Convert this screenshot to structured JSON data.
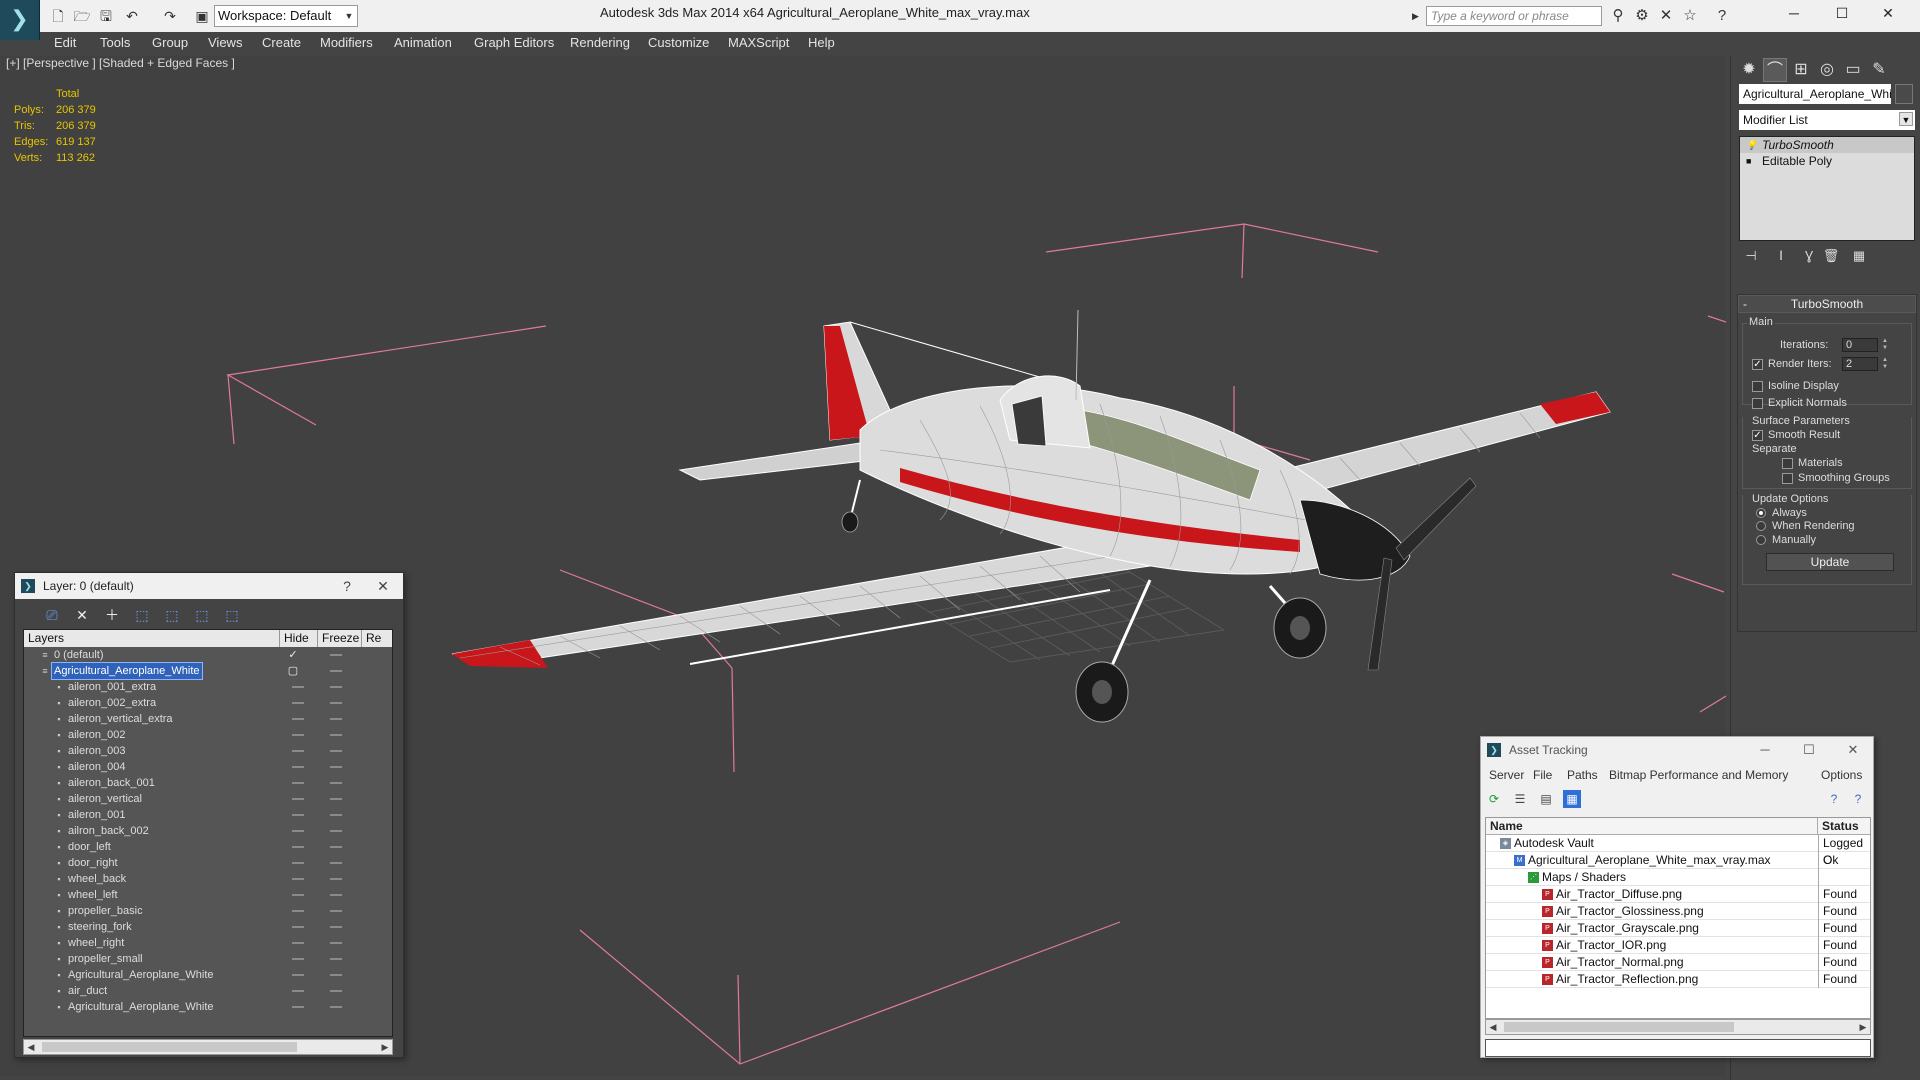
{
  "app": {
    "title": "Autodesk 3ds Max  2014 x64      Agricultural_Aeroplane_White_max_vray.max",
    "logo": "3ds-max-logo",
    "workspace": "Workspace: Default",
    "search_placeholder": "Type a keyword or phrase"
  },
  "menu": [
    "Edit",
    "Tools",
    "Group",
    "Views",
    "Create",
    "Modifiers",
    "Animation",
    "Graph Editors",
    "Rendering",
    "Customize",
    "MAXScript",
    "Help"
  ],
  "viewport": {
    "label": "[+] [Perspective ] [Shaded + Edged Faces ]",
    "stats_header": "Total",
    "stats": [
      {
        "label": "Polys:",
        "value": "206 379"
      },
      {
        "label": "Tris:",
        "value": "206 379"
      },
      {
        "label": "Edges:",
        "value": "619 137"
      },
      {
        "label": "Verts:",
        "value": "113 262"
      }
    ]
  },
  "command_panel": {
    "object_name": "Agricultural_Aeroplane_White",
    "modifier_list": "Modifier List",
    "stack": [
      "TurboSmooth",
      "Editable Poly"
    ],
    "rollout_title": "TurboSmooth",
    "main_group": "Main",
    "iterations_label": "Iterations:",
    "iterations_value": "0",
    "render_iters_label": "Render Iters:",
    "render_iters_value": "2",
    "isoline_label": "Isoline Display",
    "explicit_label": "Explicit Normals",
    "surface_group": "Surface Parameters",
    "smooth_result_label": "Smooth Result",
    "separate_label": "Separate",
    "materials_label": "Materials",
    "smoothing_groups_label": "Smoothing Groups",
    "update_group": "Update Options",
    "always_label": "Always",
    "when_rendering_label": "When Rendering",
    "manually_label": "Manually",
    "update_button": "Update"
  },
  "layer_panel": {
    "title": "Layer: 0 (default)",
    "help": "?",
    "columns": [
      "Layers",
      "Hide",
      "Freeze",
      "Re"
    ],
    "rows": [
      {
        "name": "0 (default)",
        "level": 0,
        "type": "layer"
      },
      {
        "name": "Agricultural_Aeroplane_White",
        "level": 0,
        "type": "layer",
        "selected": true
      },
      {
        "name": "aileron_001_extra",
        "level": 1,
        "type": "object"
      },
      {
        "name": "aileron_002_extra",
        "level": 1,
        "type": "object"
      },
      {
        "name": "aileron_vertical_extra",
        "level": 1,
        "type": "object"
      },
      {
        "name": "aileron_002",
        "level": 1,
        "type": "object"
      },
      {
        "name": "aileron_003",
        "level": 1,
        "type": "object"
      },
      {
        "name": "aileron_004",
        "level": 1,
        "type": "object"
      },
      {
        "name": "aileron_back_001",
        "level": 1,
        "type": "object"
      },
      {
        "name": "aileron_vertical",
        "level": 1,
        "type": "object"
      },
      {
        "name": "aileron_001",
        "level": 1,
        "type": "object"
      },
      {
        "name": "ailron_back_002",
        "level": 1,
        "type": "object"
      },
      {
        "name": "door_left",
        "level": 1,
        "type": "object"
      },
      {
        "name": "door_right",
        "level": 1,
        "type": "object"
      },
      {
        "name": "wheel_back",
        "level": 1,
        "type": "object"
      },
      {
        "name": "wheel_left",
        "level": 1,
        "type": "object"
      },
      {
        "name": "propeller_basic",
        "level": 1,
        "type": "object"
      },
      {
        "name": "steering_fork",
        "level": 1,
        "type": "object"
      },
      {
        "name": "wheel_right",
        "level": 1,
        "type": "object"
      },
      {
        "name": "propeller_small",
        "level": 1,
        "type": "object"
      },
      {
        "name": "Agricultural_Aeroplane_White",
        "level": 1,
        "type": "object"
      },
      {
        "name": "air_duct",
        "level": 1,
        "type": "object"
      },
      {
        "name": "Agricultural_Aeroplane_White",
        "level": 1,
        "type": "object"
      }
    ]
  },
  "asset_panel": {
    "title": "Asset Tracking",
    "menu": [
      "Server",
      "File",
      "Paths",
      "Bitmap Performance and Memory",
      "Options"
    ],
    "columns": [
      "Name",
      "Status"
    ],
    "rows": [
      {
        "name": "Autodesk Vault",
        "level": 0,
        "status": "Logged O",
        "kind": "vault"
      },
      {
        "name": "Agricultural_Aeroplane_White_max_vray.max",
        "level": 1,
        "status": "Ok",
        "kind": "max"
      },
      {
        "name": "Maps / Shaders",
        "level": 2,
        "status": "",
        "kind": "maps"
      },
      {
        "name": "Air_Tractor_Diffuse.png",
        "level": 3,
        "status": "Found",
        "kind": "png"
      },
      {
        "name": "Air_Tractor_Glossiness.png",
        "level": 3,
        "status": "Found",
        "kind": "png"
      },
      {
        "name": "Air_Tractor_Grayscale.png",
        "level": 3,
        "status": "Found",
        "kind": "png"
      },
      {
        "name": "Air_Tractor_IOR.png",
        "level": 3,
        "status": "Found",
        "kind": "png"
      },
      {
        "name": "Air_Tractor_Normal.png",
        "level": 3,
        "status": "Found",
        "kind": "png"
      },
      {
        "name": "Air_Tractor_Reflection.png",
        "level": 3,
        "status": "Found",
        "kind": "png"
      }
    ]
  },
  "colors": {
    "stats": "#e6c600",
    "selection": "#2f62b8",
    "light_gizmo": "#e07a9a",
    "plane_accent": "#c8161b"
  }
}
